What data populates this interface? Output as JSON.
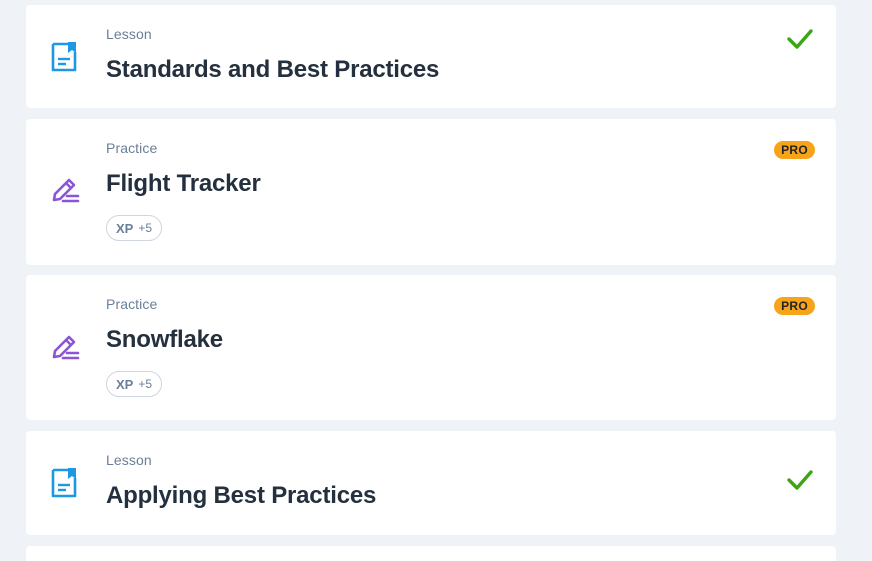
{
  "colors": {
    "lesson_icon": "#1d99e3",
    "practice_icon": "#8a55d6",
    "check": "#3aa712",
    "pro_badge": "#f8a41b",
    "background": "#eff2f6"
  },
  "items": [
    {
      "type": "Lesson",
      "title": "Standards and Best Practices",
      "icon": "lesson-document-icon",
      "status": "completed"
    },
    {
      "type": "Practice",
      "title": "Flight Tracker",
      "icon": "practice-pencil-icon",
      "badge": "PRO",
      "xp_label": "XP",
      "xp_value": "+5"
    },
    {
      "type": "Practice",
      "title": "Snowflake",
      "icon": "practice-pencil-icon",
      "badge": "PRO",
      "xp_label": "XP",
      "xp_value": "+5"
    },
    {
      "type": "Lesson",
      "title": "Applying Best Practices",
      "icon": "lesson-document-icon",
      "status": "completed"
    }
  ]
}
